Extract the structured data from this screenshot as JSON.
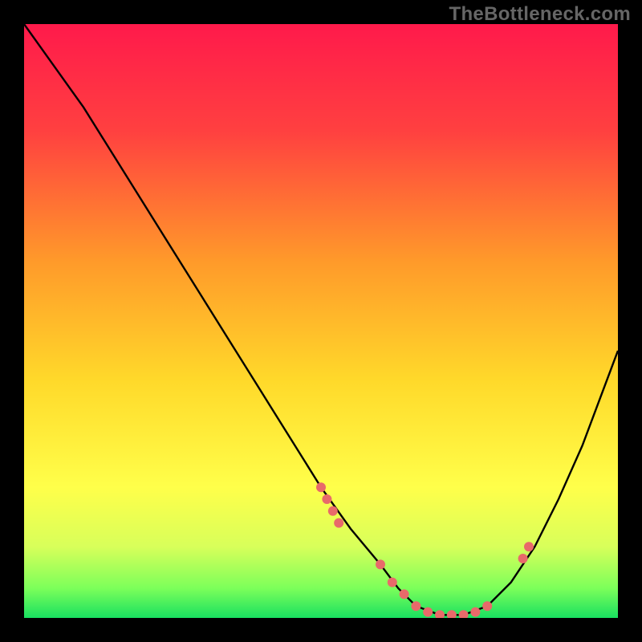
{
  "watermark": "TheBottleneck.com",
  "chart_data": {
    "type": "line",
    "title": "",
    "xlabel": "",
    "ylabel": "",
    "xlim": [
      0,
      100
    ],
    "ylim": [
      0,
      100
    ],
    "gradient_stops": [
      {
        "offset": 0,
        "color": "#ff1a4b"
      },
      {
        "offset": 18,
        "color": "#ff4040"
      },
      {
        "offset": 40,
        "color": "#ff9a2a"
      },
      {
        "offset": 60,
        "color": "#ffd92a"
      },
      {
        "offset": 78,
        "color": "#ffff4a"
      },
      {
        "offset": 88,
        "color": "#d8ff5a"
      },
      {
        "offset": 95,
        "color": "#7cff5a"
      },
      {
        "offset": 100,
        "color": "#19e060"
      }
    ],
    "series": [
      {
        "name": "bottleneck-curve",
        "x": [
          0,
          5,
          10,
          15,
          20,
          25,
          30,
          35,
          40,
          45,
          50,
          55,
          60,
          63,
          66,
          70,
          74,
          78,
          82,
          86,
          90,
          94,
          97,
          100
        ],
        "values": [
          100,
          93,
          86,
          78,
          70,
          62,
          54,
          46,
          38,
          30,
          22,
          15,
          9,
          5,
          2,
          0.5,
          0.5,
          2,
          6,
          12,
          20,
          29,
          37,
          45
        ]
      }
    ],
    "scatter_points": {
      "name": "highlight-dots",
      "color": "#e86a6a",
      "x": [
        50,
        51,
        52,
        53,
        60,
        62,
        64,
        66,
        68,
        70,
        72,
        74,
        76,
        78,
        84,
        85
      ],
      "values": [
        22,
        20,
        18,
        16,
        9,
        6,
        4,
        2,
        1,
        0.5,
        0.5,
        0.5,
        1,
        2,
        10,
        12
      ]
    }
  }
}
